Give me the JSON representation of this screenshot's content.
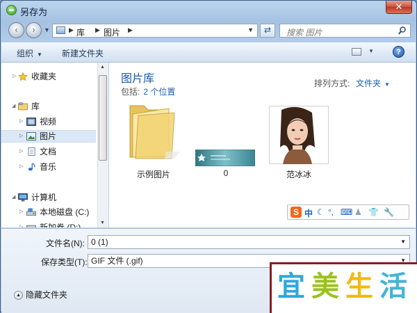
{
  "window": {
    "title": "另存为",
    "close_label": "✕"
  },
  "address_bar": {
    "crumbs": [
      "库",
      "图片"
    ],
    "search_placeholder": "搜索 图片"
  },
  "toolbar": {
    "organize": "组织",
    "new_folder": "新建文件夹"
  },
  "sidebar": {
    "items": [
      {
        "label": "收藏夹",
        "icon": "star-icon"
      },
      {
        "label": "库",
        "icon": "library-icon"
      },
      {
        "label": "视频",
        "icon": "video-icon"
      },
      {
        "label": "图片",
        "icon": "picture-icon",
        "selected": true
      },
      {
        "label": "文档",
        "icon": "document-icon"
      },
      {
        "label": "音乐",
        "icon": "music-icon"
      },
      {
        "label": "计算机",
        "icon": "computer-icon"
      },
      {
        "label": "本地磁盘 (C:)",
        "icon": "drive-icon"
      },
      {
        "label": "新加卷 (D:)",
        "icon": "drive-icon"
      }
    ]
  },
  "content": {
    "library_title": "图片库",
    "includes_label": "包括:",
    "includes_link": "2 个位置",
    "sort_label": "排列方式:",
    "sort_value": "文件夹",
    "files": [
      {
        "label": "示例图片",
        "type": "folder"
      },
      {
        "label": "0",
        "type": "image"
      },
      {
        "label": "范冰冰",
        "type": "image"
      }
    ]
  },
  "ime_toolbar": {
    "logo": "S",
    "mode": "中"
  },
  "form": {
    "filename_label": "文件名(N):",
    "filename_value": "0 (1)",
    "filetype_label": "保存类型(T):",
    "filetype_value": "GIF 文件 (.gif)",
    "hide_folders": "隐藏文件夹"
  },
  "watermark": {
    "chars": [
      "宜",
      "美",
      "生",
      "活"
    ],
    "colors": [
      "#2ea7df",
      "#9bc21c",
      "#f2b90e",
      "#42b4d8"
    ]
  }
}
